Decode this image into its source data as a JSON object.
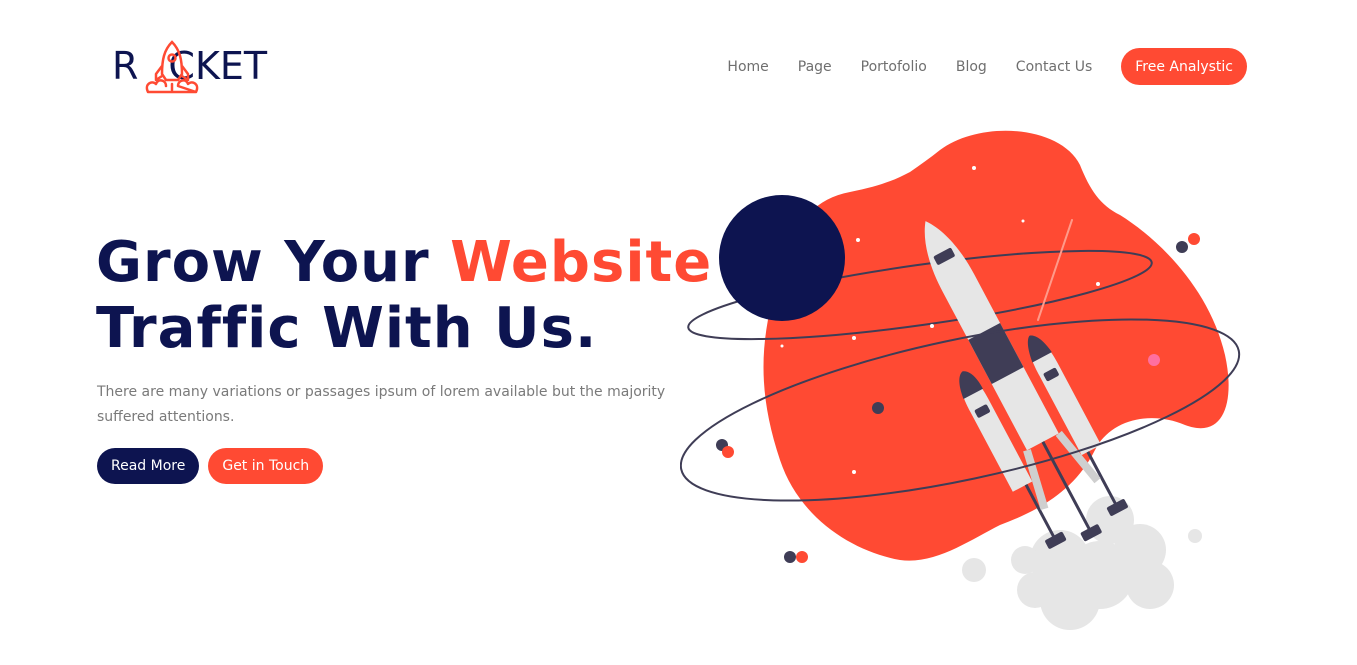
{
  "brand": {
    "logo_text_left": "R",
    "logo_text_right": "CKET"
  },
  "nav": {
    "items": [
      "Home",
      "Page",
      "Portofolio",
      "Blog",
      "Contact Us"
    ],
    "cta_label": "Free Analystic"
  },
  "hero": {
    "title_line1_prefix": "Grow Your ",
    "title_line1_accent": "Website",
    "title_line2": "Traffic With Us.",
    "description": "There are many variations or passages ipsum of lorem available but the majority suffered attentions.",
    "primary_button": "Read More",
    "secondary_button": "Get in Touch"
  },
  "colors": {
    "accent": "#ff4a33",
    "navy": "#0d1450",
    "text_muted": "#7a7a7a"
  },
  "icons": {
    "logo": "rocket-icon",
    "illustration": "rocket-launch-illustration"
  }
}
